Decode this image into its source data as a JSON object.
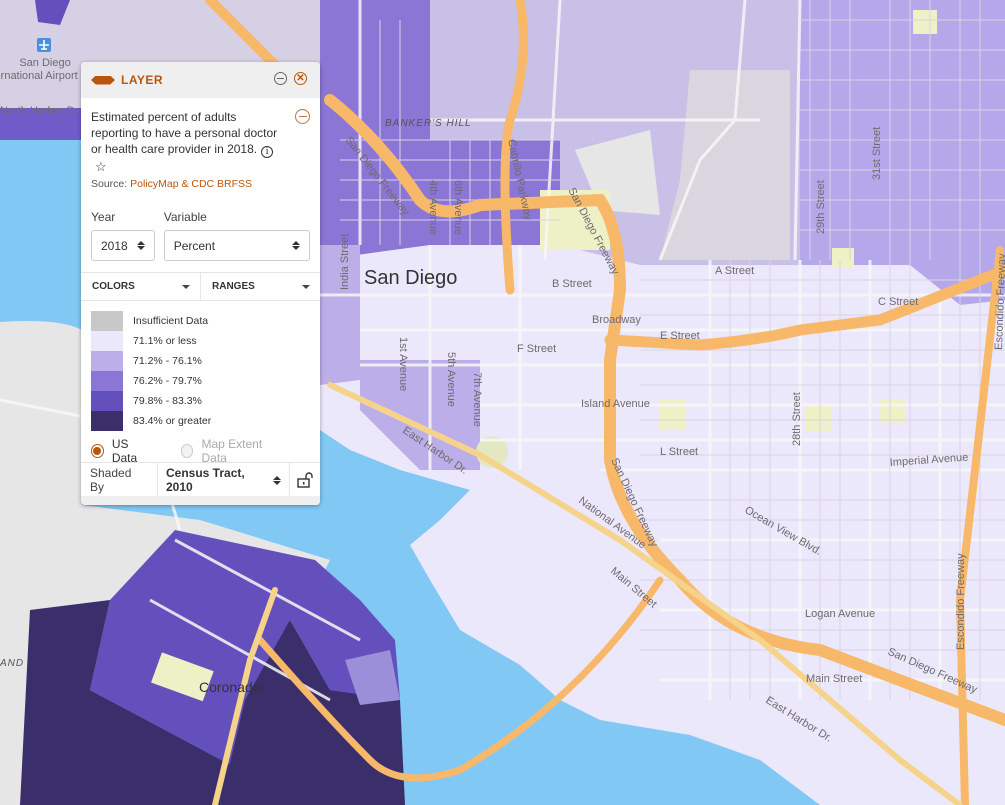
{
  "map": {
    "labels": {
      "airport": [
        "San Diego",
        "International Airport"
      ],
      "north_harbor": "North Harbor Dr.",
      "bankers_hill": "BANKER'S HILL",
      "san_diego_freeway": "San Diego Freeway",
      "cabrillo": "Cabrillo Parkway",
      "fourth_ave": "4th Avenue",
      "sixth_ave": "6th Avenue",
      "india_st": "India Street",
      "city": "San Diego",
      "b_street": "B Street",
      "a_street": "A Street",
      "c_street": "C Street",
      "broadway": "Broadway",
      "e_street": "E Street",
      "f_street": "F Street",
      "first_ave": "1st Avenue",
      "fifth_ave": "5th Avenue",
      "seventh_ave": "7th Avenue",
      "island_ave": "Island Avenue",
      "l_street": "L Street",
      "east_harbor": "East Harbor Dr.",
      "national_ave": "National Avenue",
      "main_street": "Main Street",
      "main_street2": "Main Street",
      "ocean_view": "Ocean View Blvd.",
      "imperial_ave": "Imperial Avenue",
      "twenty_eighth": "28th Street",
      "twenty_ninth": "29th Street",
      "thirty_first": "31st Street",
      "logan_ave": "Logan Avenue",
      "escondido": "Escondido Freeway",
      "coronado": "Coronado",
      "island": "AND"
    },
    "colors": {
      "water": "#82c8f5",
      "land": "#ebebeb",
      "freeway": "#f8b86a",
      "park": "#eef1c5"
    }
  },
  "panel": {
    "title": "LAYER",
    "description": "Estimated percent of adults reporting to have a personal doctor or health care provider in 2018.",
    "source_prefix": "Source: ",
    "source_link": "PolicyMap & CDC BRFSS",
    "year_label": "Year",
    "year_value": "2018",
    "variable_label": "Variable",
    "variable_value": "Percent",
    "colors_label": "COLORS",
    "ranges_label": "RANGES",
    "legend": [
      {
        "label": "Insufficient Data",
        "color": "#c8c8c8"
      },
      {
        "label": "71.1% or less",
        "color": "#ece8fb"
      },
      {
        "label": "71.2% - 76.1%",
        "color": "#bcaee8"
      },
      {
        "label": "76.2% - 79.7%",
        "color": "#8b76d6"
      },
      {
        "label": "79.8% - 83.3%",
        "color": "#6450bd"
      },
      {
        "label": "83.4% or greater",
        "color": "#3a2f6b"
      }
    ],
    "radio_us": "US Data",
    "radio_extent": "Map Extent Data",
    "shaded_by_label": "Shaded By",
    "shaded_by_value": "Census Tract, 2010",
    "accent": "#b8560e"
  }
}
